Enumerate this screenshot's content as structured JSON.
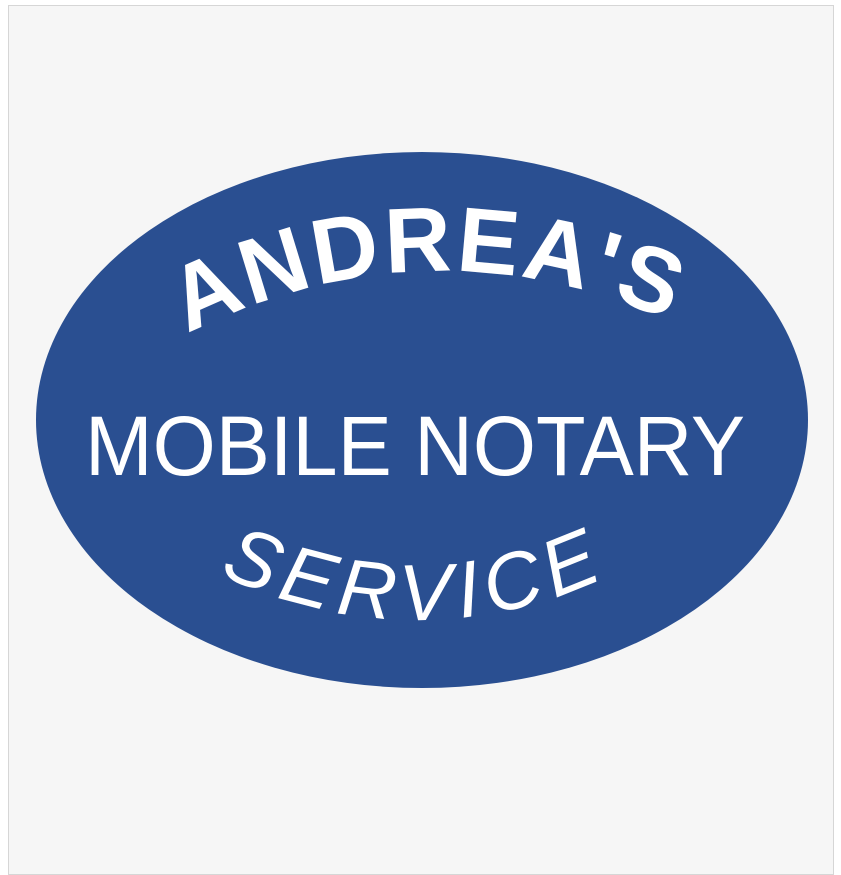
{
  "logo": {
    "line_top": "ANDREA'S",
    "line_middle": "MOBILE NOTARY",
    "line_bottom": "SERVICE"
  },
  "colors": {
    "background": "#f6f6f6",
    "border": "#d6d6d6",
    "oval": "#2a4f91",
    "text": "#ffffff"
  }
}
